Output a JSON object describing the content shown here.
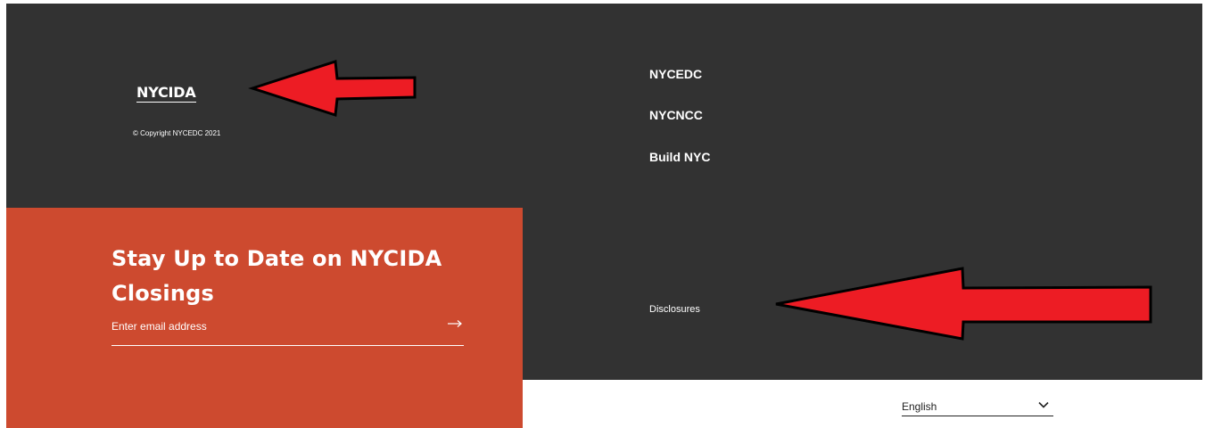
{
  "brand": {
    "logo_text": "NYCIDA",
    "copyright": "© Copyright NYCEDC 2021"
  },
  "nav": {
    "links": [
      {
        "label": "NYCEDC"
      },
      {
        "label": "NYCNCC"
      },
      {
        "label": "Build NYC"
      }
    ],
    "disclosures_label": "Disclosures"
  },
  "signup": {
    "heading": "Stay Up to Date on NYCIDA Closings",
    "email_placeholder": "Enter email address",
    "submit_icon": "arrow-right-icon"
  },
  "language": {
    "selected": "English",
    "icon": "chevron-down-icon"
  },
  "colors": {
    "footer_bg": "#323232",
    "signup_bg": "#cd4a2f",
    "annotation_arrow": "#ed1c24"
  },
  "annotations": [
    {
      "icon": "red-arrow-left-icon",
      "points_to": "logo"
    },
    {
      "icon": "red-arrow-left-icon",
      "points_to": "disclosures"
    }
  ]
}
